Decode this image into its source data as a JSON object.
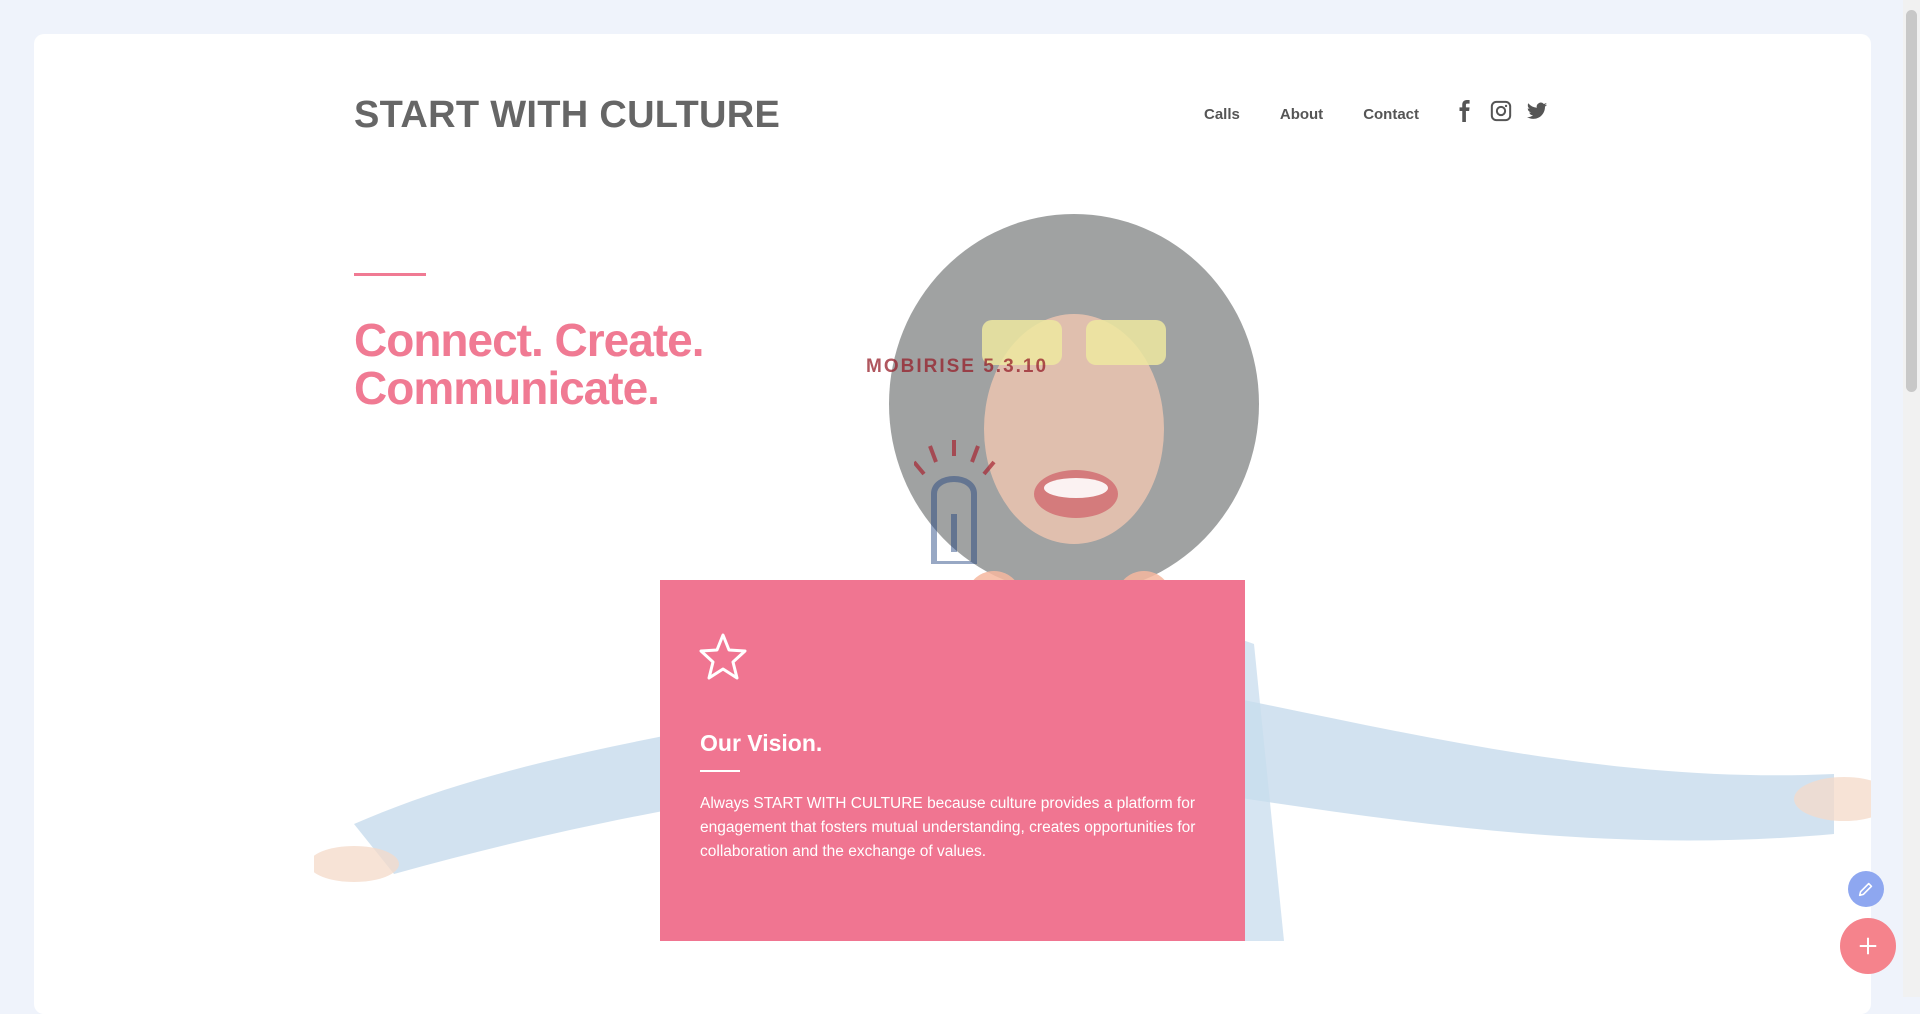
{
  "navbar": {
    "brand": "START WITH CULTURE",
    "links": [
      "Calls",
      "About",
      "Contact"
    ],
    "socials": [
      "facebook-icon",
      "instagram-icon",
      "twitter-icon"
    ]
  },
  "hero": {
    "headline_line1": "Connect. Create.",
    "headline_line2": "Communicate.",
    "accent_color": "#f07a93",
    "watermark": "MOBIRISE 5.3.10"
  },
  "vision": {
    "icon": "star-icon",
    "title": "Our Vision.",
    "text": "Always START WITH CULTURE because culture provides a platform for engagement that fosters mutual understanding, creates opportunities for collaboration and the exchange of values.",
    "background_color": "#f07591"
  },
  "floating_buttons": {
    "edit": "pencil-icon",
    "add": "plus-icon"
  }
}
